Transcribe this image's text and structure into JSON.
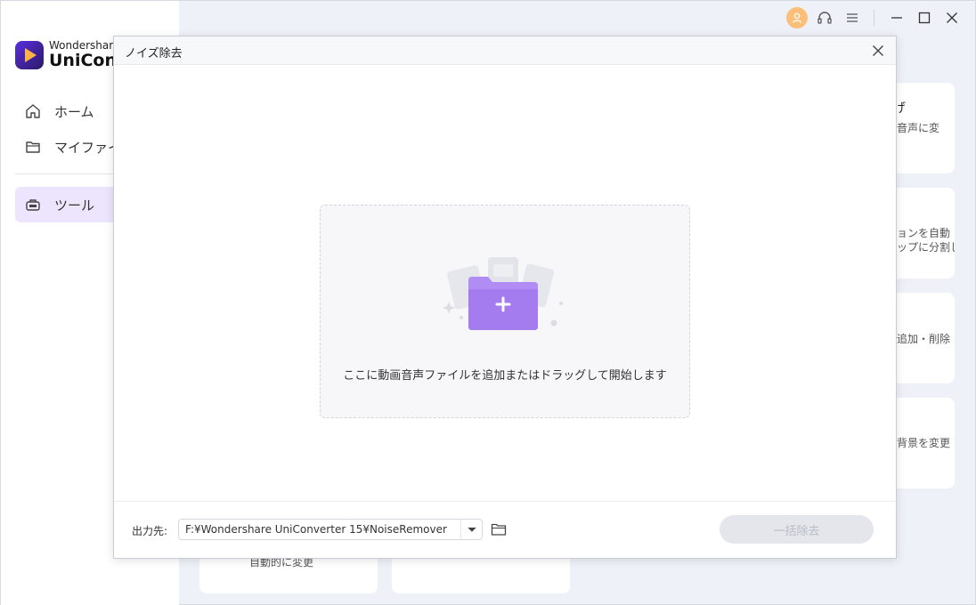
{
  "app": {
    "brand_small": "Wondershare",
    "brand_big": "UniConv",
    "nav": [
      {
        "label": "ホーム",
        "icon": "home-icon"
      },
      {
        "label": "マイファイル",
        "icon": "folder-icon"
      },
      {
        "label": "ツール",
        "icon": "toolbox-icon",
        "active": true
      }
    ],
    "accent_color": "#ece5fd"
  },
  "background_cards": [
    {
      "title": "げ",
      "line1": "音声に変"
    },
    {
      "line1": "ョンを自動",
      "line2": "ップに分割し"
    },
    {
      "line1": "追加・削除"
    },
    {
      "line1": "背景を変更"
    },
    {
      "line1": "自動的に変更"
    }
  ],
  "dialog": {
    "title": "ノイズ除去",
    "drop_text": "ここに動画音声ファイルを追加またはドラッグして開始します",
    "output_label": "出力先:",
    "output_path": "F:¥Wondershare UniConverter 15¥NoiseRemover",
    "batch_button": "一括除去"
  }
}
